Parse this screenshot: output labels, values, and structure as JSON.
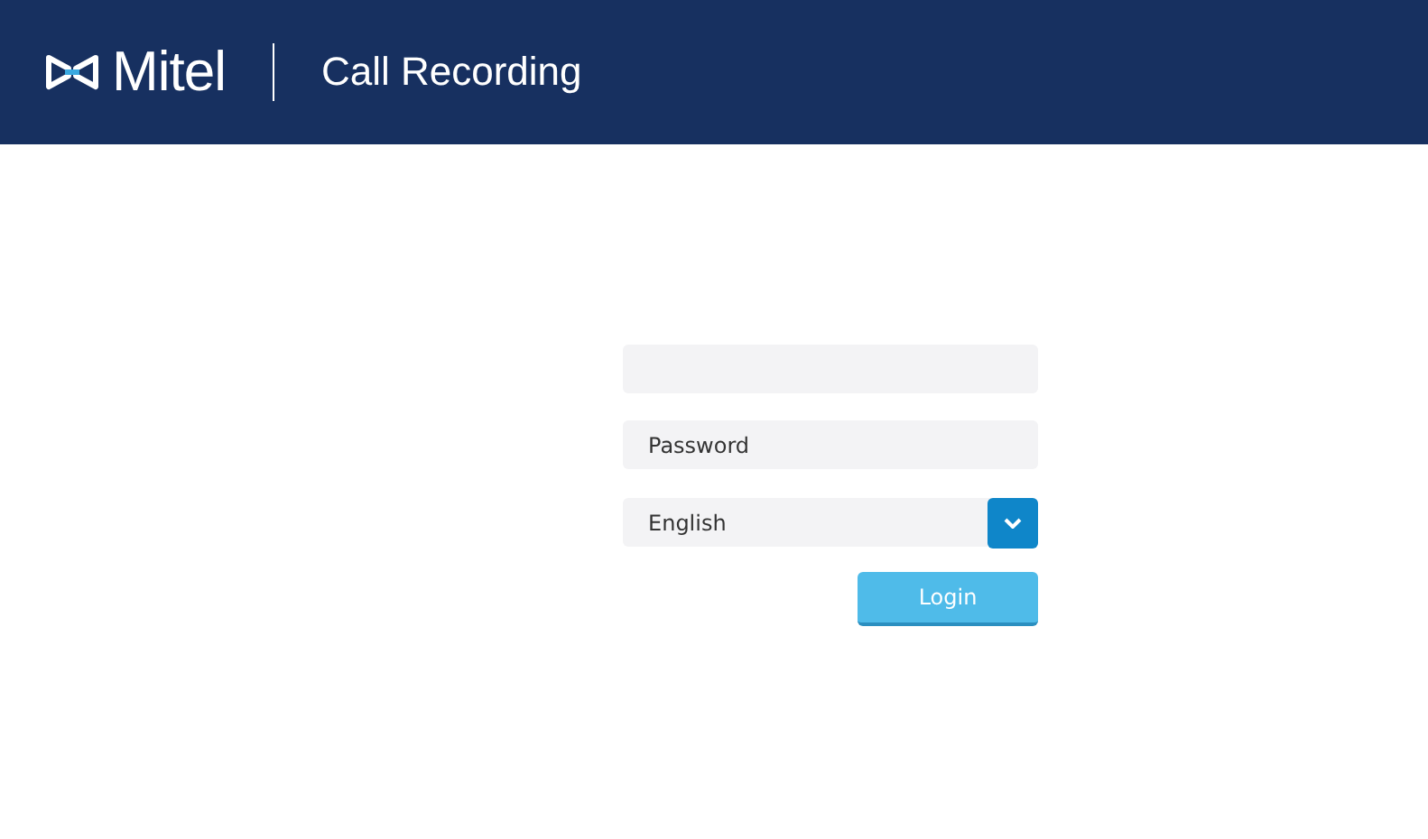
{
  "header": {
    "brand": "Mitel",
    "title": "Call Recording"
  },
  "login_form": {
    "password": {
      "placeholder": "Password"
    },
    "language": {
      "value": "English"
    },
    "submit": "Login"
  }
}
